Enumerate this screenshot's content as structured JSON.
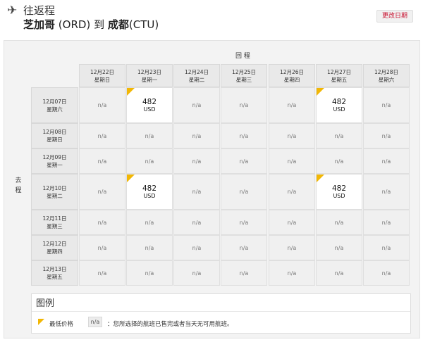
{
  "header": {
    "trip_type": "往返程",
    "origin_city": "芝加哥",
    "origin_code": "(ORD)",
    "to_word": "到",
    "dest_city": "成都",
    "dest_code": "(CTU)",
    "change_dates_label": "更改日期"
  },
  "calendar": {
    "return_label": "回 程",
    "depart_label": "去 程",
    "columns": [
      {
        "date": "12月22日",
        "weekday": "星期日"
      },
      {
        "date": "12月23日",
        "weekday": "星期一"
      },
      {
        "date": "12月24日",
        "weekday": "星期二"
      },
      {
        "date": "12月25日",
        "weekday": "星期三"
      },
      {
        "date": "12月26日",
        "weekday": "星期四"
      },
      {
        "date": "12月27日",
        "weekday": "星期五"
      },
      {
        "date": "12月28日",
        "weekday": "星期六"
      }
    ],
    "rows": [
      {
        "date": "12月07日",
        "weekday": "星期六",
        "cells": [
          "n/a",
          {
            "price": "482",
            "currency": "USD",
            "lowest": true
          },
          "n/a",
          "n/a",
          "n/a",
          {
            "price": "482",
            "currency": "USD",
            "lowest": true
          },
          "n/a"
        ]
      },
      {
        "date": "12月08日",
        "weekday": "星期日",
        "cells": [
          "n/a",
          "n/a",
          "n/a",
          "n/a",
          "n/a",
          "n/a",
          "n/a"
        ]
      },
      {
        "date": "12月09日",
        "weekday": "星期一",
        "cells": [
          "n/a",
          "n/a",
          "n/a",
          "n/a",
          "n/a",
          "n/a",
          "n/a"
        ]
      },
      {
        "date": "12月10日",
        "weekday": "星期二",
        "cells": [
          "n/a",
          {
            "price": "482",
            "currency": "USD",
            "lowest": true
          },
          "n/a",
          "n/a",
          "n/a",
          {
            "price": "482",
            "currency": "USD",
            "lowest": true
          },
          "n/a"
        ]
      },
      {
        "date": "12月11日",
        "weekday": "星期三",
        "cells": [
          "n/a",
          "n/a",
          "n/a",
          "n/a",
          "n/a",
          "n/a",
          "n/a"
        ]
      },
      {
        "date": "12月12日",
        "weekday": "星期四",
        "cells": [
          "n/a",
          "n/a",
          "n/a",
          "n/a",
          "n/a",
          "n/a",
          "n/a"
        ]
      },
      {
        "date": "12月13日",
        "weekday": "星期五",
        "cells": [
          "n/a",
          "n/a",
          "n/a",
          "n/a",
          "n/a",
          "n/a",
          "n/a"
        ]
      }
    ]
  },
  "legend": {
    "title": "图例",
    "lowest_label": "最低价格",
    "na_label": "n/a",
    "na_desc": "：您所选择的航班已售完或者当天无可用航班。"
  },
  "colors": {
    "lowest_flag": "#f2b705",
    "change_button_text": "#c8102e"
  },
  "icons": {
    "plane": "plane-icon"
  }
}
